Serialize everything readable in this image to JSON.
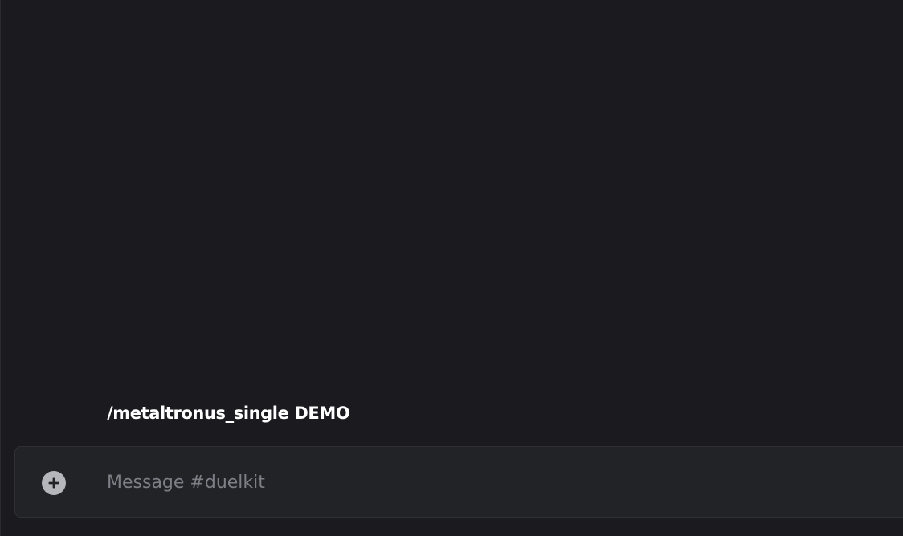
{
  "messages": [
    {
      "text": "/metaltronus_single DEMO"
    }
  ],
  "composer": {
    "placeholder": "Message #duelkit",
    "value": "",
    "attach_icon": "plus-circle-icon"
  },
  "colors": {
    "background": "#1b1b1f",
    "composer_bg": "#222327",
    "composer_border": "#303137",
    "icon": "#b5b6bb",
    "placeholder": "#7d7f86",
    "message_text": "#ffffff"
  }
}
